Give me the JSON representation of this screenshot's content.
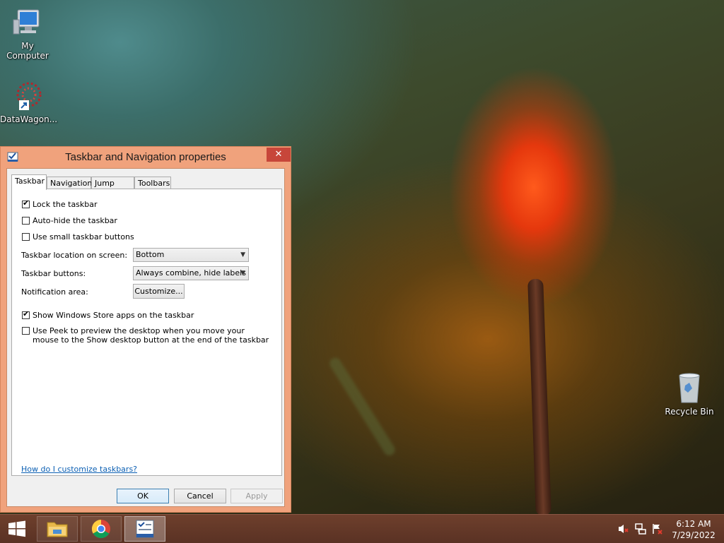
{
  "desktop": {
    "icons": [
      {
        "label": "My Computer",
        "icon": "computer-icon"
      },
      {
        "label": "DataWagon...",
        "icon": "datawagon-shortcut-icon"
      },
      {
        "label": "Recycle Bin",
        "icon": "recycle-bin-icon"
      }
    ]
  },
  "dialog": {
    "title": "Taskbar and Navigation properties",
    "close_label": "✕",
    "tabs": [
      {
        "label": "Taskbar",
        "active": true
      },
      {
        "label": "Navigation",
        "active": false
      },
      {
        "label": "Jump Lists",
        "active": false
      },
      {
        "label": "Toolbars",
        "active": false
      }
    ],
    "options": {
      "lock_taskbar": {
        "label": "Lock the taskbar",
        "checked": true
      },
      "auto_hide": {
        "label": "Auto-hide the taskbar",
        "checked": false
      },
      "small_buttons": {
        "label": "Use small taskbar buttons",
        "checked": false
      },
      "show_store_apps": {
        "label": "Show Windows Store apps on the taskbar",
        "checked": true
      },
      "use_peek": {
        "label": "Use Peek to preview the desktop when you move your mouse to the Show desktop button at the end of the taskbar",
        "checked": false
      }
    },
    "location": {
      "label": "Taskbar location on screen:",
      "value": "Bottom"
    },
    "buttons_combine": {
      "label": "Taskbar buttons:",
      "value": "Always combine, hide labels"
    },
    "notification": {
      "label": "Notification area:",
      "button": "Customize..."
    },
    "help_link": "How do I customize taskbars?",
    "ok": "OK",
    "cancel": "Cancel",
    "apply": "Apply"
  },
  "taskbar": {
    "pinned": [
      {
        "name": "file-explorer",
        "icon": "folder-icon"
      },
      {
        "name": "chrome",
        "icon": "chrome-icon"
      },
      {
        "name": "taskbar-properties",
        "icon": "taskbar-properties-icon",
        "active": true
      }
    ],
    "tray_icons": [
      "volume-muted-icon",
      "network-icon",
      "action-center-flag-icon"
    ],
    "time": "6:12 AM",
    "date": "7/29/2022"
  },
  "colors": {
    "dialog_frame": "#f0a27c",
    "close_button": "#c7463a",
    "taskbar": "#5a3224",
    "link": "#0b5fb3"
  }
}
